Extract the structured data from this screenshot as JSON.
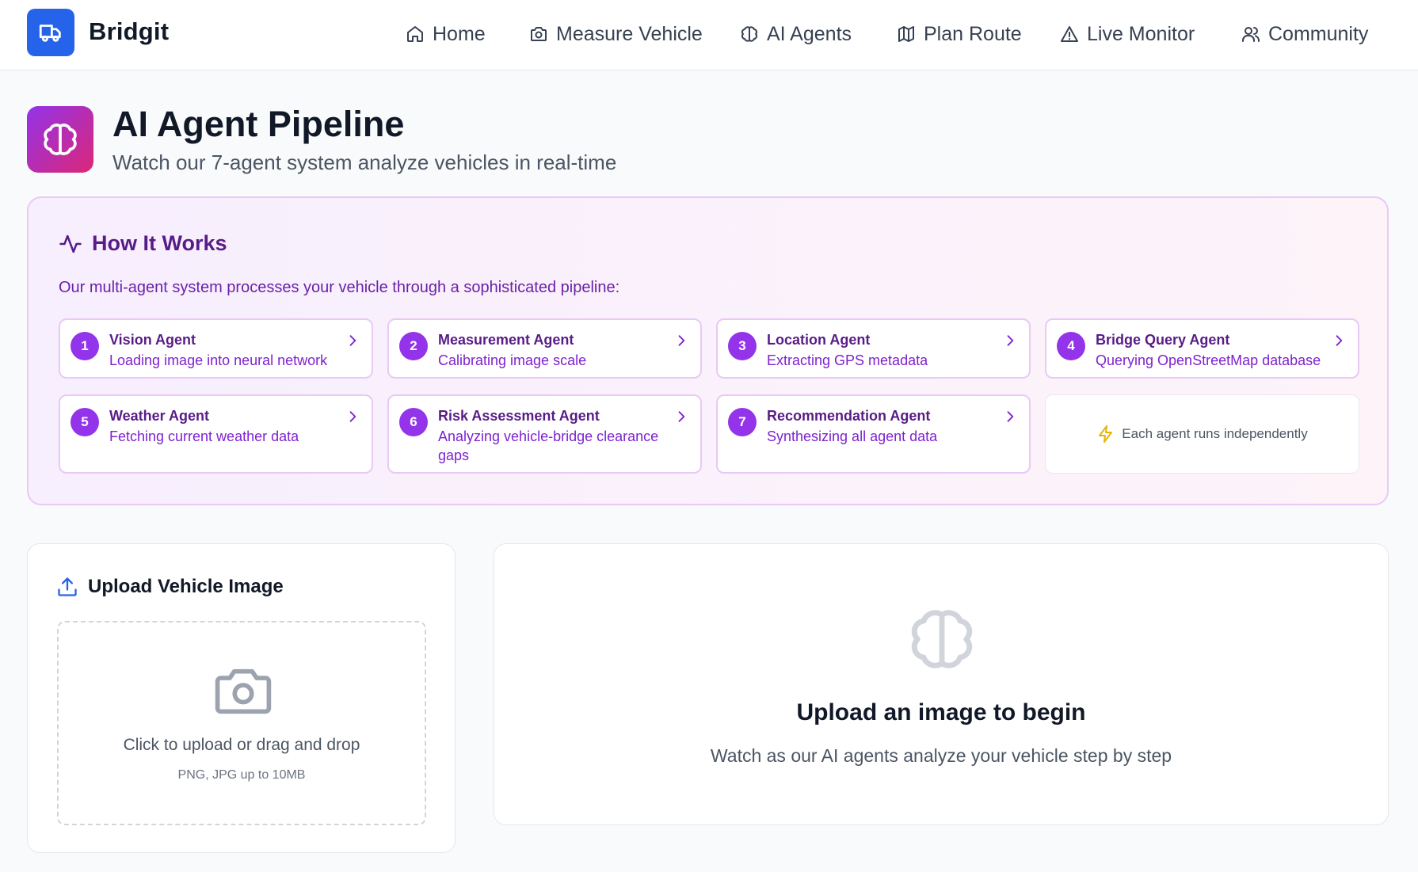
{
  "header": {
    "brand": "Bridgit",
    "nav": [
      {
        "label": "Home",
        "icon": "home-icon"
      },
      {
        "label": "Measure Vehicle",
        "icon": "camera-icon"
      },
      {
        "label": "AI Agents",
        "icon": "brain-icon"
      },
      {
        "label": "Plan Route",
        "icon": "map-icon"
      },
      {
        "label": "Live Monitor",
        "icon": "alert-triangle-icon"
      },
      {
        "label": "Community",
        "icon": "users-icon"
      }
    ]
  },
  "page": {
    "title": "AI Agent Pipeline",
    "subtitle": "Watch our 7-agent system analyze vehicles in real-time"
  },
  "how_it_works": {
    "title": "How It Works",
    "description": "Our multi-agent system processes your vehicle through a sophisticated pipeline:",
    "agents": [
      {
        "num": "1",
        "name": "Vision Agent",
        "desc": "Loading image into neural network"
      },
      {
        "num": "2",
        "name": "Measurement Agent",
        "desc": "Calibrating image scale"
      },
      {
        "num": "3",
        "name": "Location Agent",
        "desc": "Extracting GPS metadata"
      },
      {
        "num": "4",
        "name": "Bridge Query Agent",
        "desc": "Querying OpenStreetMap database"
      },
      {
        "num": "5",
        "name": "Weather Agent",
        "desc": "Fetching current weather data"
      },
      {
        "num": "6",
        "name": "Risk Assessment Agent",
        "desc": "Analyzing vehicle-bridge clearance gaps"
      },
      {
        "num": "7",
        "name": "Recommendation Agent",
        "desc": "Synthesizing all agent data"
      }
    ],
    "note": "Each agent runs independently"
  },
  "upload": {
    "title": "Upload Vehicle Image",
    "dropzone_text": "Click to upload or drag and drop",
    "dropzone_hint": "PNG, JPG up to 10MB"
  },
  "result": {
    "title": "Upload an image to begin",
    "subtitle": "Watch as our AI agents analyze your vehicle step by step"
  },
  "colors": {
    "brand_blue": "#2563eb",
    "accent_purple": "#9333ea",
    "accent_pink": "#db2777",
    "note_bolt": "#eab308"
  }
}
